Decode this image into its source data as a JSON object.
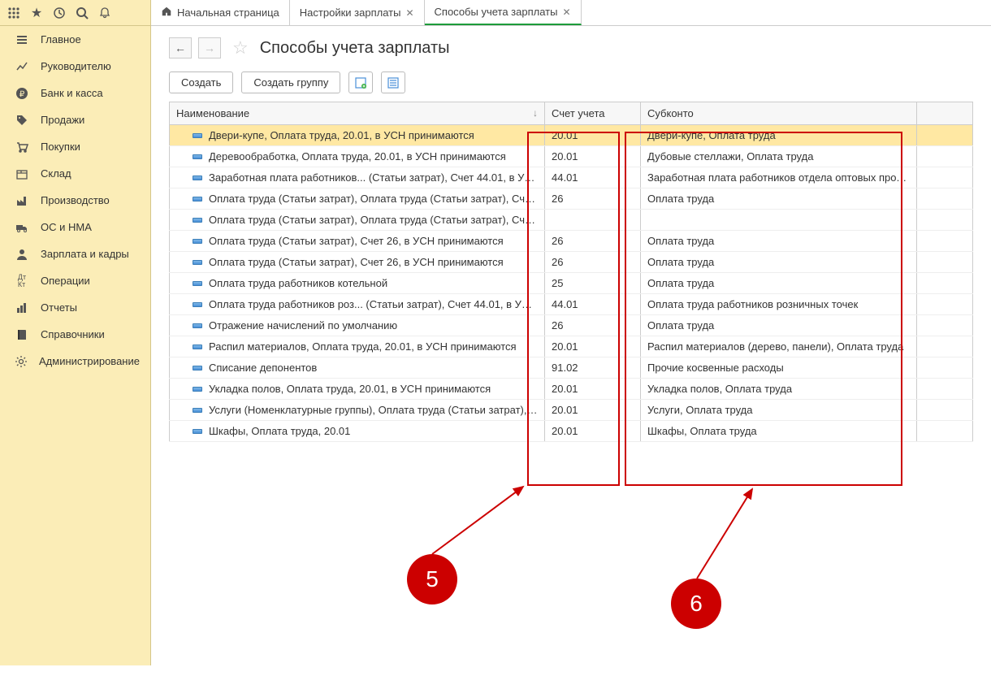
{
  "tabs": {
    "home": "Начальная страница",
    "settings": "Настройки зарплаты",
    "current": "Способы учета зарплаты"
  },
  "title": "Способы учета зарплаты",
  "toolbar": {
    "create": "Создать",
    "create_group": "Создать группу"
  },
  "columns": {
    "name": "Наименование",
    "account": "Счет учета",
    "subconto": "Субконто"
  },
  "nav": [
    "Главное",
    "Руководителю",
    "Банк и касса",
    "Продажи",
    "Покупки",
    "Склад",
    "Производство",
    "ОС и НМА",
    "Зарплата и кадры",
    "Операции",
    "Отчеты",
    "Справочники",
    "Администрирование"
  ],
  "nav_icons": [
    "menu",
    "chart",
    "ruble",
    "tag",
    "cart",
    "box",
    "factory",
    "truck",
    "person",
    "dtkt",
    "bars",
    "book",
    "gear"
  ],
  "rows": [
    {
      "name": "Двери-купе, Оплата труда, 20.01, в УСН принимаются",
      "acc": "20.01",
      "sub": "Двери-купе, Оплата труда",
      "selected": true
    },
    {
      "name": "Деревообработка, Оплата труда, 20.01, в УСН принимаются",
      "acc": "20.01",
      "sub": "Дубовые стеллажи, Оплата труда"
    },
    {
      "name": "Заработная плата работников... (Статьи затрат), Счет 44.01, в УС...",
      "acc": "44.01",
      "sub": "Заработная плата работников отдела оптовых продаж"
    },
    {
      "name": "Оплата труда (Статьи затрат), Оплата труда (Статьи затрат), Счет...",
      "acc": "26",
      "sub": "Оплата труда"
    },
    {
      "name": "Оплата труда (Статьи затрат), Оплата труда (Статьи затрат), Счет...",
      "acc": "",
      "sub": ""
    },
    {
      "name": "Оплата труда (Статьи затрат), Счет 26, в УСН принимаются",
      "acc": "26",
      "sub": "Оплата труда"
    },
    {
      "name": "Оплата труда (Статьи затрат), Счет 26, в УСН принимаются",
      "acc": "26",
      "sub": "Оплата труда"
    },
    {
      "name": "Оплата труда работников котельной",
      "acc": "25",
      "sub": "Оплата труда"
    },
    {
      "name": "Оплата труда работников роз... (Статьи затрат), Счет 44.01, в УС...",
      "acc": "44.01",
      "sub": "Оплата труда работников розничных точек"
    },
    {
      "name": "Отражение начислений по умолчанию",
      "acc": "26",
      "sub": "Оплата труда"
    },
    {
      "name": "Распил материалов, Оплата труда, 20.01, в УСН принимаются",
      "acc": "20.01",
      "sub": "Распил материалов (дерево, панели), Оплата труда"
    },
    {
      "name": "Списание депонентов",
      "acc": "91.02",
      "sub": "Прочие косвенные расходы"
    },
    {
      "name": "Укладка полов, Оплата труда, 20.01, в УСН принимаются",
      "acc": "20.01",
      "sub": "Укладка полов, Оплата труда"
    },
    {
      "name": "Услуги (Номенклатурные группы), Оплата труда (Статьи затрат), ...",
      "acc": "20.01",
      "sub": "Услуги, Оплата труда"
    },
    {
      "name": "Шкафы, Оплата труда, 20.01",
      "acc": "20.01",
      "sub": "Шкафы, Оплата труда"
    }
  ],
  "annotations": {
    "five": "5",
    "six": "6"
  }
}
